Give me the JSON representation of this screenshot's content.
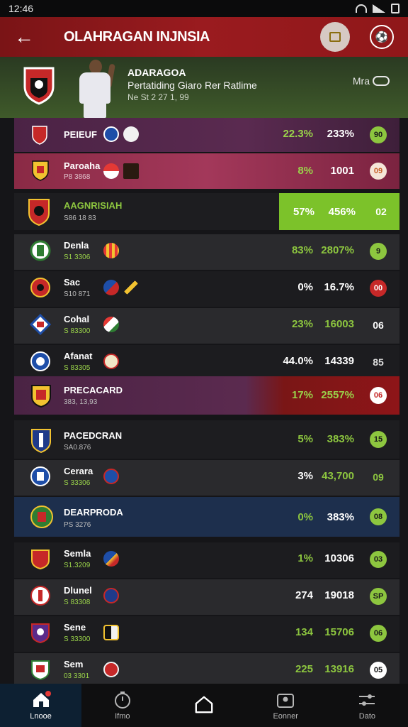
{
  "status_bar": {
    "time": "12:46",
    "battery": "▮"
  },
  "app_bar": {
    "title": "OLAHRAGAN INJNSIA",
    "back_icon": "arrow-left-icon",
    "chat_icon": "chat-icon",
    "ball_icon": "soccer-ball-icon"
  },
  "hero": {
    "name": "ADARAGOA",
    "subtitle": "Pertatiding Giaro Rer Ratlime",
    "meta": "Ne St 2 27 1, 99",
    "more_label": "Mra"
  },
  "colors": {
    "accent_green": "#8dc63f",
    "brand_red": "#8e1518",
    "purple": "#54264e",
    "pink": "#8f2b48",
    "navy": "#1d2f4d"
  },
  "rows": [
    {
      "name": "PEIEUF",
      "sub": "",
      "pct": "22.3%",
      "val": "233%",
      "badge": "90"
    },
    {
      "name": "Paroaha",
      "sub": "P8 3868",
      "pct": "8%",
      "val": "1001",
      "badge": "09"
    },
    {
      "name": "AAGNRISIAH",
      "sub": "S86 18 83",
      "pct": "57%",
      "val": "456%",
      "badge": "02"
    },
    {
      "name": "Denla",
      "sub": "S1 3306",
      "pct": "83%",
      "val": "2807%",
      "badge": "9"
    },
    {
      "name": "Sac",
      "sub": "S10 871",
      "pct": "0%",
      "val": "16.7%",
      "badge": "00"
    },
    {
      "name": "Cohal",
      "sub": "S 83300",
      "pct": "23%",
      "val": "16003",
      "badge": "06"
    },
    {
      "name": "Afanat",
      "sub": "S 83305",
      "pct": "44.0%",
      "val": "14339",
      "badge": "85"
    },
    {
      "name": "PRECACARD",
      "sub": "383, 13,93",
      "pct": "17%",
      "val": "2557%",
      "badge": "06"
    },
    {
      "name": "PACEDCRAN",
      "sub": "SA0.876",
      "pct": "5%",
      "val": "383%",
      "badge": "15"
    },
    {
      "name": "Cerara",
      "sub": "S 33306",
      "pct": "3%",
      "val": "43,700",
      "badge": "09"
    },
    {
      "name": "DEARPRODA",
      "sub": "PS 3276",
      "pct": "0%",
      "val": "383%",
      "badge": "08"
    },
    {
      "name": "Semla",
      "sub": "S1.3209",
      "pct": "1%",
      "val": "10306",
      "badge": "03"
    },
    {
      "name": "Dlunel",
      "sub": "S 83308",
      "pct": "274",
      "val": "19018",
      "badge": "SP"
    },
    {
      "name": "Sene",
      "sub": "S 33300",
      "pct": "134",
      "val": "15706",
      "badge": "06"
    },
    {
      "name": "Sem",
      "sub": "03 3301",
      "pct": "225",
      "val": "13916",
      "badge": "05"
    }
  ],
  "nav": [
    {
      "label": "Lnooe",
      "icon": "home-icon"
    },
    {
      "label": "Ifmo",
      "icon": "stopwatch-icon"
    },
    {
      "label": "",
      "icon": "house-outline-icon"
    },
    {
      "label": "Eonner",
      "icon": "user-card-icon"
    },
    {
      "label": "Dato",
      "icon": "sliders-icon"
    }
  ]
}
